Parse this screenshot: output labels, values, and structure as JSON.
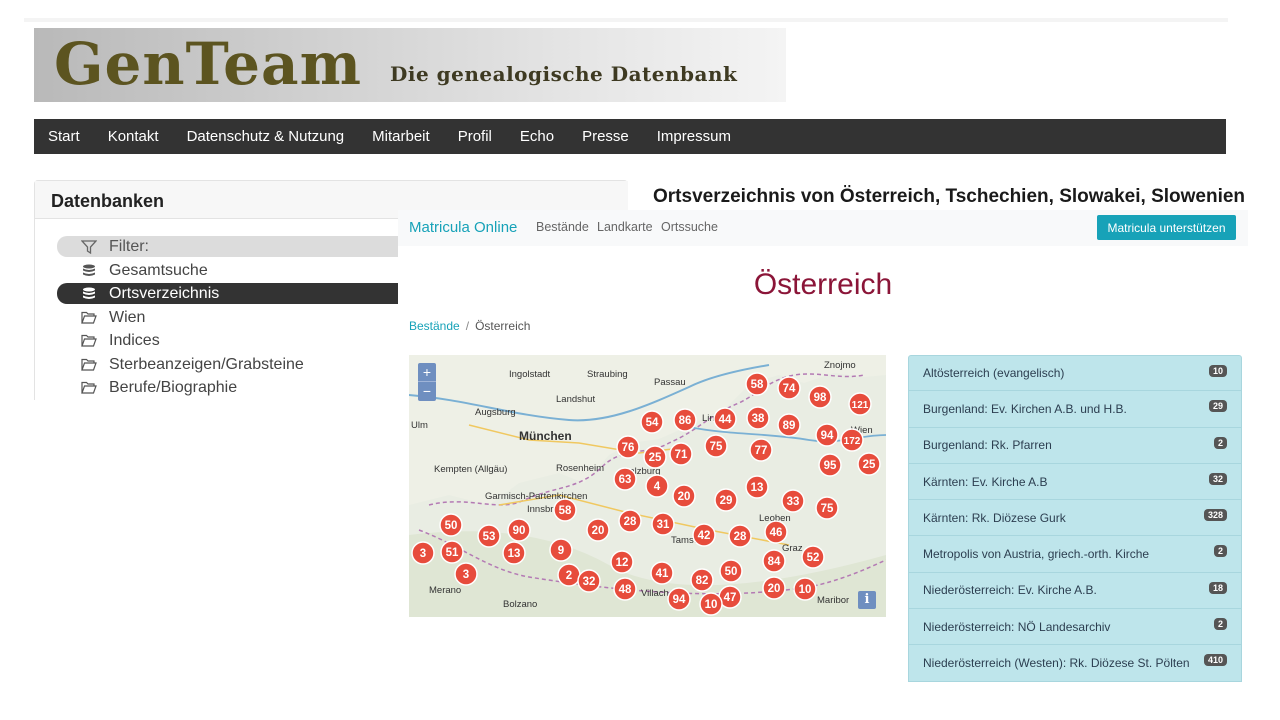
{
  "header": {
    "logo_text": "GenTeam",
    "tagline": "Die genealogische Datenbank"
  },
  "nav": {
    "items": [
      "Start",
      "Kontakt",
      "Datenschutz & Nutzung",
      "Mitarbeit",
      "Profil",
      "Echo",
      "Presse",
      "Impressum"
    ]
  },
  "sidebar": {
    "title": "Datenbanken",
    "items": [
      {
        "label": "Filter:",
        "icon": "filter-icon",
        "state": "filter"
      },
      {
        "label": "Gesamtsuche",
        "icon": "database-icon",
        "state": "normal"
      },
      {
        "label": "Ortsverzeichnis",
        "icon": "database-icon",
        "state": "active"
      },
      {
        "label": "Wien",
        "icon": "folder-open-icon",
        "state": "normal"
      },
      {
        "label": "Indices",
        "icon": "folder-open-icon",
        "state": "normal"
      },
      {
        "label": "Sterbeanzeigen/Grabsteine",
        "icon": "folder-open-icon",
        "state": "normal"
      },
      {
        "label": "Berufe/Biographie",
        "icon": "folder-open-icon",
        "state": "normal"
      }
    ]
  },
  "main": {
    "title": "Ortsverzeichnis von Österreich, Tschechien, Slowakei, Slowenien"
  },
  "matricula": {
    "brand": "Matricula Online",
    "links": [
      "Bestände",
      "Landkarte",
      "Ortssuche"
    ],
    "support_button": "Matricula unterstützen",
    "page_title": "Österreich",
    "breadcrumb": {
      "link": "Bestände",
      "current": "Österreich"
    },
    "map": {
      "zoom_in": "+",
      "zoom_out": "−",
      "info": "i",
      "place_labels": [
        "Ingolstadt",
        "Straubing",
        "Passau",
        "Landshut",
        "Augsburg",
        "Ulm",
        "München",
        "Kempten (Allgäu)",
        "Rosenheim",
        "Garmisch-Partenkirchen",
        "Bolzano",
        "Merano",
        "Znojmo",
        "Maribor",
        "Graz",
        "Leoben",
        "Villach",
        "Tamsweg",
        "Linz",
        "Wien",
        "Salzburg",
        "Innsbruck"
      ],
      "clusters": [
        58,
        74,
        98,
        121,
        54,
        86,
        44,
        38,
        89,
        94,
        172,
        76,
        25,
        71,
        75,
        77,
        95,
        25,
        63,
        4,
        20,
        29,
        13,
        33,
        58,
        28,
        31,
        75,
        50,
        90,
        53,
        20,
        42,
        28,
        46,
        3,
        51,
        13,
        9,
        52,
        84,
        3,
        12,
        41,
        50,
        2,
        32,
        48,
        82,
        47,
        20,
        10,
        94,
        10
      ]
    },
    "list": [
      {
        "label": "Altösterreich (evangelisch)",
        "count": "10"
      },
      {
        "label": "Burgenland: Ev. Kirchen A.B. und H.B.",
        "count": "29"
      },
      {
        "label": "Burgenland: Rk. Pfarren",
        "count": "2"
      },
      {
        "label": "Kärnten: Ev. Kirche A.B",
        "count": "32"
      },
      {
        "label": "Kärnten: Rk. Diözese Gurk",
        "count": "328"
      },
      {
        "label": "Metropolis von Austria, griech.-orth. Kirche",
        "count": "2"
      },
      {
        "label": "Niederösterreich: Ev. Kirche A.B.",
        "count": "18"
      },
      {
        "label": "Niederösterreich: NÖ Landesarchiv",
        "count": "2"
      },
      {
        "label": "Niederösterreich (Westen): Rk. Diözese St. Pölten",
        "count": "410"
      }
    ]
  },
  "colors": {
    "nav_bg": "#333333",
    "accent": "#17a2b8",
    "title": "#8b1538",
    "marker": "#e74c3c",
    "list_bg": "#bee5eb"
  }
}
